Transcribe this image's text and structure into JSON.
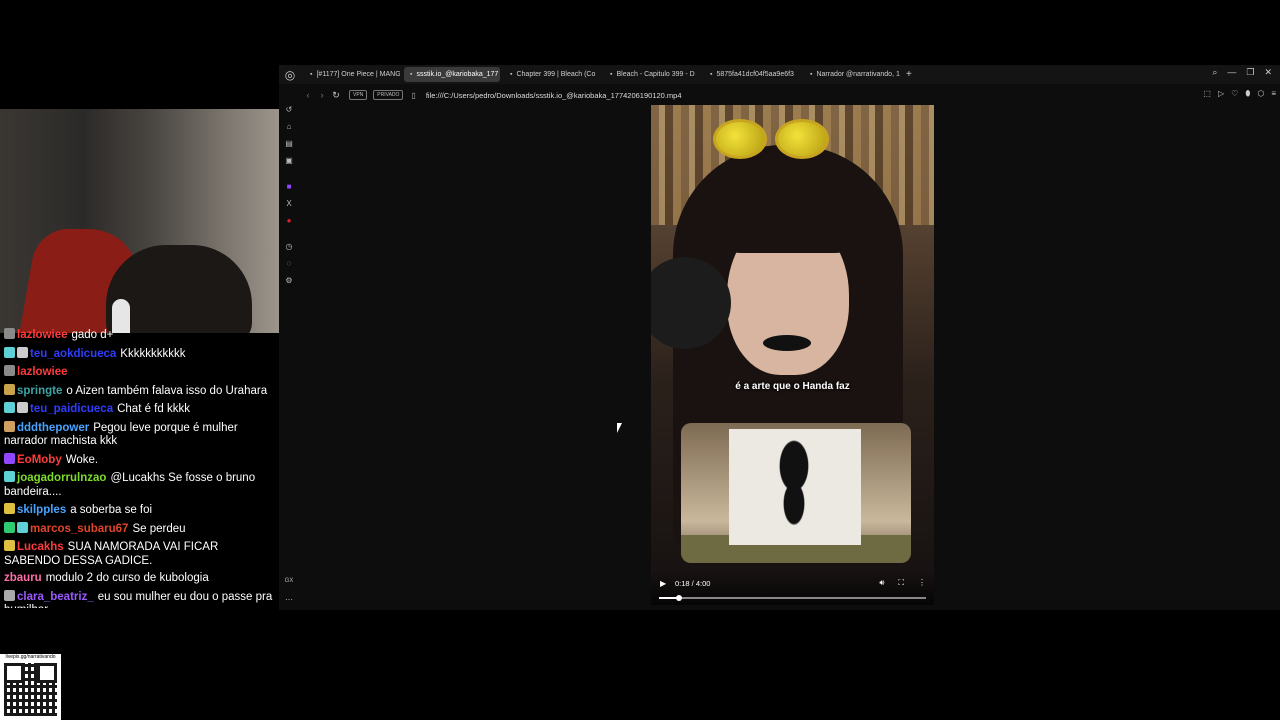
{
  "browser": {
    "tabs": [
      {
        "label": "[#1177] One Piece | MANG",
        "icon": "page-icon",
        "active": false
      },
      {
        "label": "ssstik.io_@kariobaka_177",
        "icon": "page-icon",
        "active": true
      },
      {
        "label": "Chapter 399 | Bleach (Co",
        "icon": "page-icon",
        "active": false
      },
      {
        "label": "Bleach - Capitulo 399 - D",
        "icon": "page-icon",
        "active": false
      },
      {
        "label": "5875fa41dcf04f5aa9e6f3",
        "icon": "page-icon",
        "active": false
      },
      {
        "label": "Narrador @narrativando, 1",
        "icon": "page-icon",
        "active": false
      }
    ],
    "new_tab": "+",
    "address": {
      "vpn_label": "VPN",
      "private_label": "PRIVADO",
      "url": "file:///C:/Users/pedro/Downloads/ssstik.io_@kariobaka_1774206190120.mp4"
    }
  },
  "video": {
    "subtitle": "é a arte que o Handa faz",
    "time": "0:18 / 4:00",
    "progress_fraction": 0.075
  },
  "chat": [
    {
      "user": "lazlowiee",
      "text": "gado d+",
      "color": "#ff3b3b",
      "badges": [
        "#8a8a8a"
      ]
    },
    {
      "user": "teu_aokdicueca",
      "text": "Kkkkkkkkkkk",
      "color": "#2f3dff",
      "badges": [
        "#5fd0d6",
        "#cccccc"
      ]
    },
    {
      "user": "lazlowiee",
      "text": "",
      "color": "#ff3b3b",
      "badges": [
        "#8a8a8a"
      ]
    },
    {
      "user": "springte",
      "text": "o Aizen também falava isso do Urahara",
      "color": "#3fa4a4",
      "badges": [
        "#c9a34a"
      ]
    },
    {
      "user": "teu_paidicueca",
      "text": "Chat é fd kkkk",
      "color": "#2f3dff",
      "badges": [
        "#5fd0d6",
        "#cccccc"
      ]
    },
    {
      "user": "dddthepower",
      "text": "Pegou leve porque é mulher narrador machista kkk",
      "color": "#4aa3ff",
      "badges": [
        "#d0a060"
      ]
    },
    {
      "user": "EoMoby",
      "text": "Woke.",
      "color": "#ff3b3b",
      "badges": [
        "#9147ff"
      ]
    },
    {
      "user": "joagadorrulnzao",
      "text": "@Lucakhs Se fosse o bruno bandeira....",
      "color": "#7ddc2a",
      "badges": [
        "#5fd0d6"
      ]
    },
    {
      "user": "skilpples",
      "text": "a soberba se foi",
      "color": "#4aa3ff",
      "badges": [
        "#e0c040"
      ]
    },
    {
      "user": "marcos_subaru67",
      "text": "Se perdeu",
      "color": "#e0452a",
      "badges": [
        "#2ecc71",
        "#5fd0d6"
      ]
    },
    {
      "user": "Lucakhs",
      "text": "SUA NAMORADA VAI FICAR SABENDO DESSA GADICE.",
      "color": "#ff3b3b",
      "badges": [
        "#e0c040"
      ]
    },
    {
      "user": "zbauru",
      "text": "modulo 2 do curso de kubologia",
      "color": "#ff6fa8",
      "badges": []
    },
    {
      "user": "clara_beatriz_",
      "text": "eu sou mulher eu dou o passe pra humilhar",
      "color": "#9b59ff",
      "badges": [
        "#aaaaaa"
      ]
    }
  ],
  "qr": {
    "url": "livepix.gg/narrativando"
  }
}
